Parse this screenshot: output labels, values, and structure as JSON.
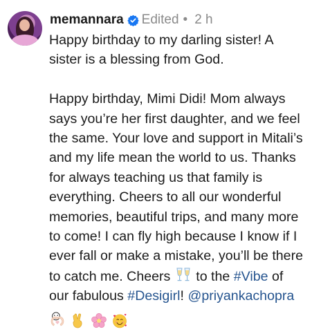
{
  "post": {
    "username": "memannara",
    "edited_label": "Edited",
    "separator": "•",
    "time_ago": "2 h",
    "paragraph1": "Happy birthday to my darling sister! A sister is a blessing from God.",
    "paragraph2_pre": "Happy birthday, Mimi Didi! Mom always says you’re her first daughter, and we feel the same. Your love and support in Mitali’s and my life mean the world to us. Thanks for always teaching us that family is everything. Cheers to all our wonderful memories, beautiful trips, and many more to come! I can fly high because I know if I ever fall or make a mistake, you’ll be there to catch me. Cheers",
    "paragraph2_mid1": "to the",
    "hashtag1": "#Vibe",
    "paragraph2_mid2": "of our fabulous",
    "hashtag2": "#Desigirl",
    "paragraph2_mid3": "!",
    "mention": "@priyankachopra",
    "smile": "☺",
    "icons": {
      "verified": "verified-badge-icon",
      "cheers": "clinking-glasses-icon",
      "heart_hands": "heart-hands-icon",
      "victory": "victory-hand-icon",
      "flower": "cherry-blossom-icon",
      "hearts_face": "smiling-face-with-hearts-icon"
    },
    "colors": {
      "link": "#25548f",
      "verified": "#1877f2",
      "meta": "#8a8a8a"
    }
  }
}
